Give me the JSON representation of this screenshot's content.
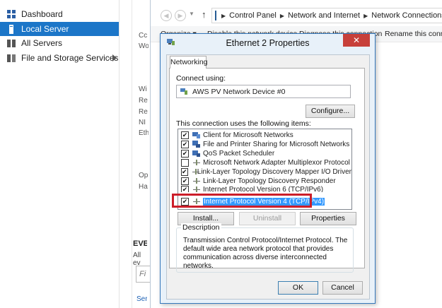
{
  "sidebar": {
    "items": [
      {
        "label": "Dashboard",
        "selected": false
      },
      {
        "label": "Local Server",
        "selected": true
      },
      {
        "label": "All Servers",
        "selected": false
      },
      {
        "label": "File and Storage Services",
        "selected": false,
        "has_submenu": true
      }
    ]
  },
  "background": {
    "fragments": [
      "Cc",
      "Wo",
      "Wi",
      "Re",
      "Re",
      "NI",
      "Eth",
      "Op",
      "Ha"
    ],
    "events_title": "EVE",
    "events_sub": "All ev",
    "filter_placeholder": "Fi",
    "link": "Ser"
  },
  "explorer": {
    "breadcrumb": [
      "Control Panel",
      "Network and Internet",
      "Network Connections"
    ],
    "toolbar": [
      "Organize ▾",
      "Disable this network device",
      "Diagnose this connection",
      "Rename this connect"
    ]
  },
  "dialog": {
    "title": "Ethernet 2 Properties",
    "close_label": "✕",
    "tab": "Networking",
    "connect_using_label": "Connect using:",
    "device": "AWS PV Network Device #0",
    "configure_button": "Configure...",
    "items_label": "This connection uses the following items:",
    "items": [
      {
        "label": "Client for Microsoft Networks",
        "checked": true,
        "icon": "client-icon"
      },
      {
        "label": "File and Printer Sharing for Microsoft Networks",
        "checked": true,
        "icon": "file-printer-icon"
      },
      {
        "label": "QoS Packet Scheduler",
        "checked": true,
        "icon": "qos-icon"
      },
      {
        "label": "Microsoft Network Adapter Multiplexor Protocol",
        "checked": false,
        "icon": "protocol-icon"
      },
      {
        "label": "Link-Layer Topology Discovery Mapper I/O Driver",
        "checked": true,
        "icon": "protocol-icon"
      },
      {
        "label": "Link-Layer Topology Discovery Responder",
        "checked": true,
        "icon": "protocol-icon"
      },
      {
        "label": "Internet Protocol Version 6 (TCP/IPv6)",
        "checked": true,
        "icon": "protocol-icon"
      },
      {
        "label": "Internet Protocol Version 4 (TCP/IPv4)",
        "checked": true,
        "icon": "protocol-icon",
        "selected": true
      }
    ],
    "install_button": "Install...",
    "uninstall_button": "Uninstall",
    "properties_button": "Properties",
    "description_legend": "Description",
    "description": "Transmission Control Protocol/Internet Protocol. The default wide area network protocol that provides communication across diverse interconnected networks.",
    "ok_button": "OK",
    "cancel_button": "Cancel"
  },
  "colors": {
    "selection_blue": "#1c76c8",
    "highlight": "#3399ff",
    "annotation_red": "#cc1e2a",
    "close_red": "#c7403a"
  }
}
